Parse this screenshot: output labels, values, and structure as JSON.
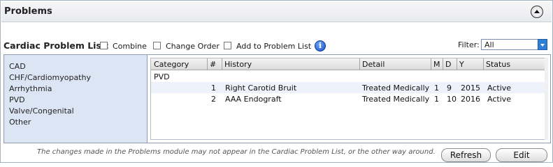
{
  "header": {
    "title": "Problems"
  },
  "toolbar": {
    "list_label": "Cardiac Problem List:",
    "checkboxes": [
      {
        "label": "Combine",
        "checked": false
      },
      {
        "label": "Change Order",
        "checked": false
      },
      {
        "label": "Add to Problem List",
        "checked": false
      }
    ],
    "filter_label": "Filter:",
    "filter_value": "All"
  },
  "categories": [
    "CAD",
    "CHF/Cardiomyopathy",
    "Arrhythmia",
    "PVD",
    "Valve/Congenital",
    "Other"
  ],
  "grid": {
    "columns": [
      "Category",
      "#",
      "History",
      "Detail",
      "M",
      "D",
      "Y",
      "Status"
    ],
    "group_label": "PVD",
    "rows": [
      {
        "num": "1",
        "history": "Right Carotid Bruit",
        "detail": "Treated Medically",
        "m": "1",
        "d": "9",
        "y": "2015",
        "status": "Active"
      },
      {
        "num": "2",
        "history": "AAA Endograft",
        "detail": "Treated Medically",
        "m": "1",
        "d": "10",
        "y": "2016",
        "status": "Active"
      }
    ]
  },
  "footer": {
    "note": "The changes made in the Problems module may not appear in the Cardiac Problem List, or the other way around.",
    "refresh_label": "Refresh",
    "edit_label": "Edit"
  },
  "colors": {
    "accent": "#2f7fd6",
    "category_bg": "#dce5f4",
    "row_highlight": "#eef2fa"
  }
}
